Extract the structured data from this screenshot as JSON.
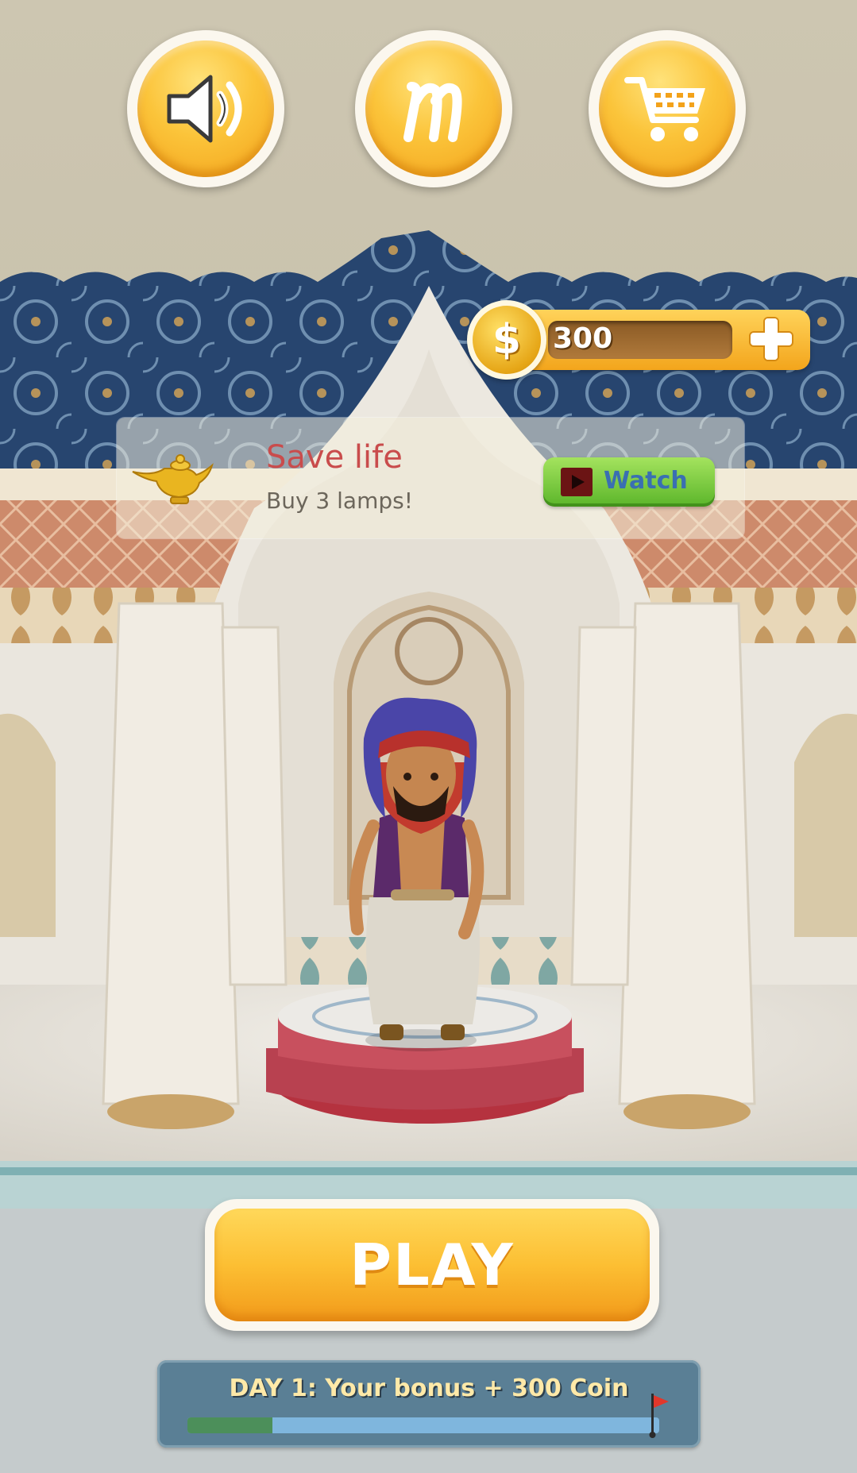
{
  "top_bar": {
    "sound_icon": "speaker-icon",
    "more_games_icon": "m-logo-icon",
    "shop_icon": "cart-icon"
  },
  "coins": {
    "icon": "dollar-coin-icon",
    "symbol": "$",
    "value": "300",
    "add_icon": "plus-icon"
  },
  "offer": {
    "icon": "magic-lamp-icon",
    "title": "Save life",
    "subtitle": "Buy 3 lamps!",
    "watch_label": "Watch",
    "watch_icon": "video-play-icon"
  },
  "play_button": {
    "label": "PLAY"
  },
  "daily_bonus": {
    "text": "DAY 1: Your bonus + 300 Coin",
    "progress": 0.18,
    "flag_icon": "goal-flag-icon"
  },
  "colors": {
    "accent_gold": "#fbc43a",
    "watch_green": "#5bb52a",
    "title_red": "#c94c4c",
    "bonus_panel": "#5a7f95"
  }
}
